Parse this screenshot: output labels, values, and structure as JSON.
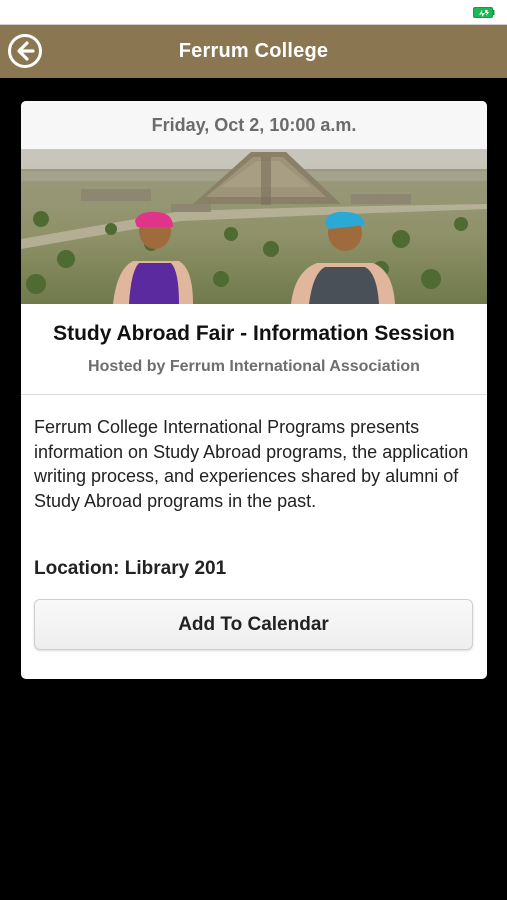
{
  "status_bar": {
    "battery_icon": "battery-charging-icon",
    "accent": "#1db954"
  },
  "header": {
    "title": "Ferrum College",
    "back_icon": "back-arrow-icon",
    "background": "#8a7650"
  },
  "event": {
    "date": "Friday, Oct 2, 10:00 a.m.",
    "title": "Study Abroad Fair - Information Session",
    "host": "Hosted by Ferrum International Association",
    "description": "Ferrum College International Programs presents information on Study Abroad programs, the application writing process, and experiences shared by alumni of Study Abroad programs in the past.",
    "location": "Location: Library 201",
    "add_button_label": "Add To Calendar"
  }
}
